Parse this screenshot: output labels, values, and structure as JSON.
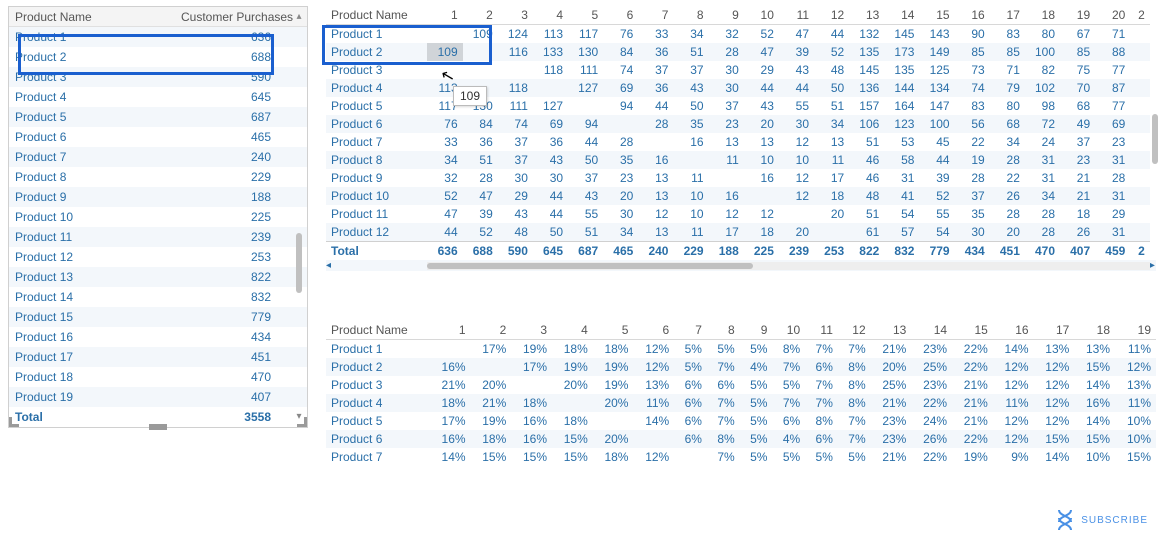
{
  "left": {
    "headers": {
      "a": "Product Name",
      "b": "Customer Purchases"
    },
    "rows": [
      {
        "name": "Product 1",
        "val": 636
      },
      {
        "name": "Product 2",
        "val": 688
      },
      {
        "name": "Product 3",
        "val": 590
      },
      {
        "name": "Product 4",
        "val": 645
      },
      {
        "name": "Product 5",
        "val": 687
      },
      {
        "name": "Product 6",
        "val": 465
      },
      {
        "name": "Product 7",
        "val": 240
      },
      {
        "name": "Product 8",
        "val": 229
      },
      {
        "name": "Product 9",
        "val": 188
      },
      {
        "name": "Product 10",
        "val": 225
      },
      {
        "name": "Product 11",
        "val": 239
      },
      {
        "name": "Product 12",
        "val": 253
      },
      {
        "name": "Product 13",
        "val": 822
      },
      {
        "name": "Product 14",
        "val": 832
      },
      {
        "name": "Product 15",
        "val": 779
      },
      {
        "name": "Product 16",
        "val": 434
      },
      {
        "name": "Product 17",
        "val": 451
      },
      {
        "name": "Product 18",
        "val": 470
      },
      {
        "name": "Product 19",
        "val": 407
      }
    ],
    "total_label": "Total",
    "total_val": 3558
  },
  "topGrid": {
    "name_header": "Product Name",
    "col_headers": [
      "1",
      "2",
      "3",
      "4",
      "5",
      "6",
      "7",
      "8",
      "9",
      "10",
      "11",
      "12",
      "13",
      "14",
      "15",
      "16",
      "17",
      "18",
      "19",
      "20",
      "2"
    ],
    "rows": [
      {
        "name": "Product 1",
        "cells": [
          "",
          "109",
          "124",
          "113",
          "117",
          "76",
          "33",
          "34",
          "32",
          "52",
          "47",
          "44",
          "132",
          "145",
          "143",
          "90",
          "83",
          "80",
          "67",
          "71"
        ]
      },
      {
        "name": "Product 2",
        "cells": [
          "109",
          "",
          "116",
          "133",
          "130",
          "84",
          "36",
          "51",
          "28",
          "47",
          "39",
          "52",
          "135",
          "173",
          "149",
          "85",
          "85",
          "100",
          "85",
          "88"
        ]
      },
      {
        "name": "Product 3",
        "cells": [
          "",
          "",
          "",
          "118",
          "111",
          "74",
          "37",
          "37",
          "30",
          "29",
          "43",
          "48",
          "145",
          "135",
          "125",
          "73",
          "71",
          "82",
          "75",
          "77"
        ]
      },
      {
        "name": "Product 4",
        "cells": [
          "113",
          "",
          "118",
          "",
          "127",
          "69",
          "36",
          "43",
          "30",
          "44",
          "44",
          "50",
          "136",
          "144",
          "134",
          "74",
          "79",
          "102",
          "70",
          "87"
        ]
      },
      {
        "name": "Product 5",
        "cells": [
          "117",
          "130",
          "111",
          "127",
          "",
          "94",
          "44",
          "50",
          "37",
          "43",
          "55",
          "51",
          "157",
          "164",
          "147",
          "83",
          "80",
          "98",
          "68",
          "77"
        ]
      },
      {
        "name": "Product 6",
        "cells": [
          "76",
          "84",
          "74",
          "69",
          "94",
          "",
          "28",
          "35",
          "23",
          "20",
          "30",
          "34",
          "106",
          "123",
          "100",
          "56",
          "68",
          "72",
          "49",
          "69"
        ]
      },
      {
        "name": "Product 7",
        "cells": [
          "33",
          "36",
          "37",
          "36",
          "44",
          "28",
          "",
          "16",
          "13",
          "13",
          "12",
          "13",
          "51",
          "53",
          "45",
          "22",
          "34",
          "24",
          "37",
          "23"
        ]
      },
      {
        "name": "Product 8",
        "cells": [
          "34",
          "51",
          "37",
          "43",
          "50",
          "35",
          "16",
          "",
          "11",
          "10",
          "10",
          "11",
          "46",
          "58",
          "44",
          "19",
          "28",
          "31",
          "23",
          "31"
        ]
      },
      {
        "name": "Product 9",
        "cells": [
          "32",
          "28",
          "30",
          "30",
          "37",
          "23",
          "13",
          "11",
          "",
          "16",
          "12",
          "17",
          "46",
          "31",
          "39",
          "28",
          "22",
          "31",
          "21",
          "28"
        ]
      },
      {
        "name": "Product 10",
        "cells": [
          "52",
          "47",
          "29",
          "44",
          "43",
          "20",
          "13",
          "10",
          "16",
          "",
          "12",
          "18",
          "48",
          "41",
          "52",
          "37",
          "26",
          "34",
          "21",
          "31"
        ]
      },
      {
        "name": "Product 11",
        "cells": [
          "47",
          "39",
          "43",
          "44",
          "55",
          "30",
          "12",
          "10",
          "12",
          "12",
          "",
          "20",
          "51",
          "54",
          "55",
          "35",
          "28",
          "28",
          "18",
          "29"
        ]
      },
      {
        "name": "Product 12",
        "cells": [
          "44",
          "52",
          "48",
          "50",
          "51",
          "34",
          "13",
          "11",
          "17",
          "18",
          "20",
          "",
          "61",
          "57",
          "54",
          "30",
          "20",
          "28",
          "26",
          "31"
        ]
      }
    ],
    "total_label": "Total",
    "totals": [
      "636",
      "688",
      "590",
      "645",
      "687",
      "465",
      "240",
      "229",
      "188",
      "225",
      "239",
      "253",
      "822",
      "832",
      "779",
      "434",
      "451",
      "470",
      "407",
      "459",
      "2"
    ],
    "tooltip": "109"
  },
  "bottomGrid": {
    "name_header": "Product Name",
    "col_headers": [
      "1",
      "2",
      "3",
      "4",
      "5",
      "6",
      "7",
      "8",
      "9",
      "10",
      "11",
      "12",
      "13",
      "14",
      "15",
      "16",
      "17",
      "18",
      "19"
    ],
    "rows": [
      {
        "name": "Product 1",
        "cells": [
          "",
          "17%",
          "19%",
          "18%",
          "18%",
          "12%",
          "5%",
          "5%",
          "5%",
          "8%",
          "7%",
          "7%",
          "21%",
          "23%",
          "22%",
          "14%",
          "13%",
          "13%",
          "11%"
        ]
      },
      {
        "name": "Product 2",
        "cells": [
          "16%",
          "",
          "17%",
          "19%",
          "19%",
          "12%",
          "5%",
          "7%",
          "4%",
          "7%",
          "6%",
          "8%",
          "20%",
          "25%",
          "22%",
          "12%",
          "12%",
          "15%",
          "12%"
        ]
      },
      {
        "name": "Product 3",
        "cells": [
          "21%",
          "20%",
          "",
          "20%",
          "19%",
          "13%",
          "6%",
          "6%",
          "5%",
          "5%",
          "7%",
          "8%",
          "25%",
          "23%",
          "21%",
          "12%",
          "12%",
          "14%",
          "13%"
        ]
      },
      {
        "name": "Product 4",
        "cells": [
          "18%",
          "21%",
          "18%",
          "",
          "20%",
          "11%",
          "6%",
          "7%",
          "5%",
          "7%",
          "7%",
          "8%",
          "21%",
          "22%",
          "21%",
          "11%",
          "12%",
          "16%",
          "11%"
        ]
      },
      {
        "name": "Product 5",
        "cells": [
          "17%",
          "19%",
          "16%",
          "18%",
          "",
          "14%",
          "6%",
          "7%",
          "5%",
          "6%",
          "8%",
          "7%",
          "23%",
          "24%",
          "21%",
          "12%",
          "12%",
          "14%",
          "10%"
        ]
      },
      {
        "name": "Product 6",
        "cells": [
          "16%",
          "18%",
          "16%",
          "15%",
          "20%",
          "",
          "6%",
          "8%",
          "5%",
          "4%",
          "6%",
          "7%",
          "23%",
          "26%",
          "22%",
          "12%",
          "15%",
          "15%",
          "10%"
        ]
      },
      {
        "name": "Product 7",
        "cells": [
          "14%",
          "15%",
          "15%",
          "15%",
          "18%",
          "12%",
          "",
          "7%",
          "5%",
          "5%",
          "5%",
          "5%",
          "21%",
          "22%",
          "19%",
          "9%",
          "14%",
          "10%",
          "15%"
        ]
      }
    ]
  },
  "watermark": "SUBSCRIBE"
}
